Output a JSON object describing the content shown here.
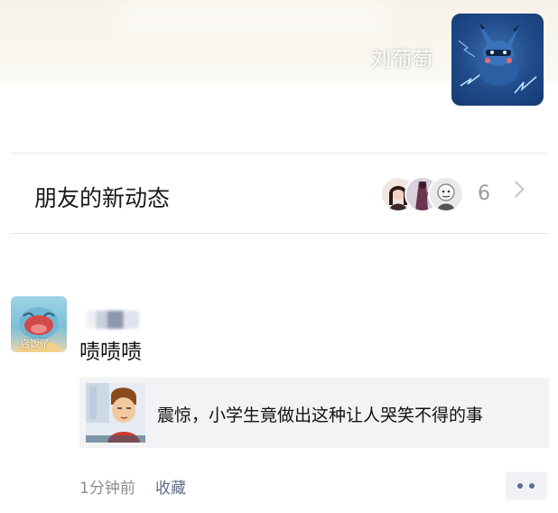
{
  "profile": {
    "nickname": "刘葡萄",
    "avatar_icon": "pokemon-avatar"
  },
  "friends_updates": {
    "label": "朋友的新动态",
    "count": "6",
    "avatar_icons": [
      "friend-avatar-woman",
      "friend-avatar-figure",
      "friend-avatar-cartoon"
    ]
  },
  "post": {
    "avatar_label": "启饭了",
    "author": "",
    "text": "啧啧啧",
    "link": {
      "title": "震惊，小学生竟做出这种让人哭笑不得的事"
    },
    "time": "1分钟前",
    "favorite_label": "收藏",
    "more_icon": "more-dots-icon"
  },
  "colors": {
    "link_blue": "#5f6d8a",
    "gray_text": "#8c8c8c",
    "card_bg": "#f3f3f5"
  }
}
